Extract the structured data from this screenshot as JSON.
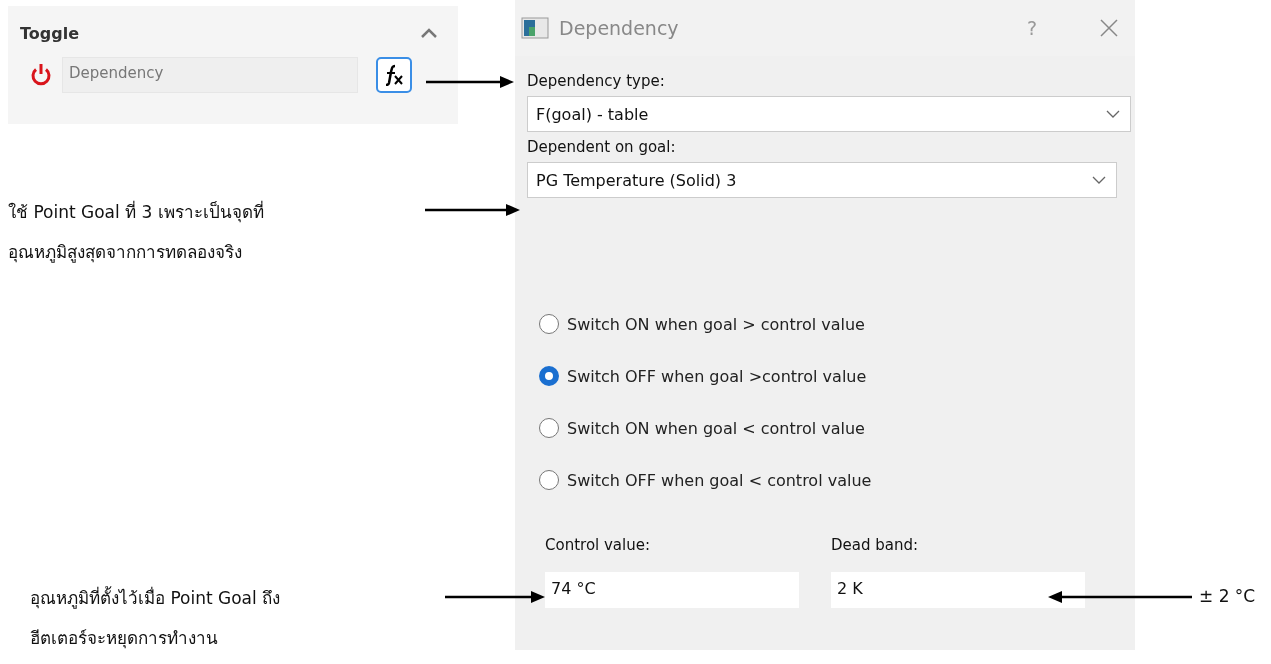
{
  "panel": {
    "title": "Toggle",
    "expanded": true,
    "field": {
      "value": "Dependency",
      "disabled": true
    }
  },
  "dialog": {
    "title": "Dependency",
    "help": "?",
    "selects": [
      {
        "label": "Dependency type:",
        "value": "F(goal) - table"
      },
      {
        "label": "Dependent on goal:",
        "value": "PG Temperature (Solid) 3"
      }
    ],
    "options": [
      {
        "label": "Switch ON when goal > control value",
        "selected": false
      },
      {
        "label": "Switch OFF when goal >control value",
        "selected": true
      },
      {
        "label": "Switch ON when goal < control value",
        "selected": false
      },
      {
        "label": "Switch OFF when goal < control value",
        "selected": false
      }
    ],
    "inputs": [
      {
        "label": "Control value:",
        "value": "74 °C"
      },
      {
        "label": "Dead band:",
        "value": "2 K"
      }
    ]
  },
  "annotations": [
    {
      "text": "ใช้ Point Goal ที่ 3 เพราะเป็นจุดที่\nอุณหภูมิสูงสุดจากการทดลองจริง"
    },
    {
      "text": "อุณหภูมิที่ตั้งไว้เมื่อ Point Goal ถึง\nฮีตเตอร์จะหยุดการทำงาน"
    },
    {
      "text": "± 2 °C"
    }
  ]
}
